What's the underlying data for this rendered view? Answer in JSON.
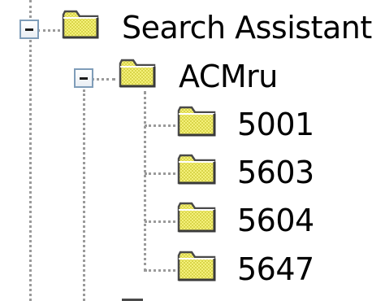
{
  "colors": {
    "folder_fill": "#f4f07a",
    "folder_check": "#d9d54a",
    "folder_outline": "#4a4a4a",
    "guide_line": "#9a9a9a",
    "toggle_border": "#7f9db9"
  },
  "tree": {
    "root": {
      "label": "Search Assistant",
      "icon": "folder-icon",
      "expanded": true
    },
    "child": {
      "label": "ACMru",
      "icon": "folder-icon",
      "expanded": true
    },
    "leaves": [
      {
        "label": "5001",
        "icon": "folder-icon"
      },
      {
        "label": "5603",
        "icon": "folder-icon"
      },
      {
        "label": "5604",
        "icon": "folder-icon"
      },
      {
        "label": "5647",
        "icon": "folder-icon"
      }
    ]
  }
}
